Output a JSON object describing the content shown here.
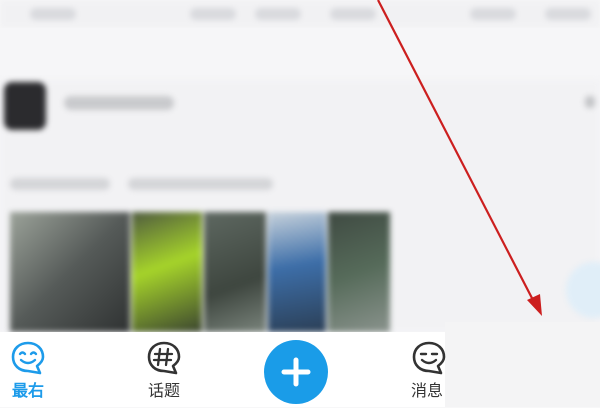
{
  "bottom_nav": {
    "items": [
      {
        "label": "最右",
        "icon": "smile-face-icon",
        "active": true
      },
      {
        "label": "话题",
        "icon": "hashtag-bubble-icon",
        "active": false
      },
      {
        "label": "",
        "icon": "plus-icon",
        "active": false
      },
      {
        "label": "消息",
        "icon": "message-face-icon",
        "active": false
      }
    ]
  },
  "colors": {
    "accent": "#1d9bea",
    "add_button": "#1a9ce8",
    "annotation_arrow": "#cc1f1f"
  }
}
